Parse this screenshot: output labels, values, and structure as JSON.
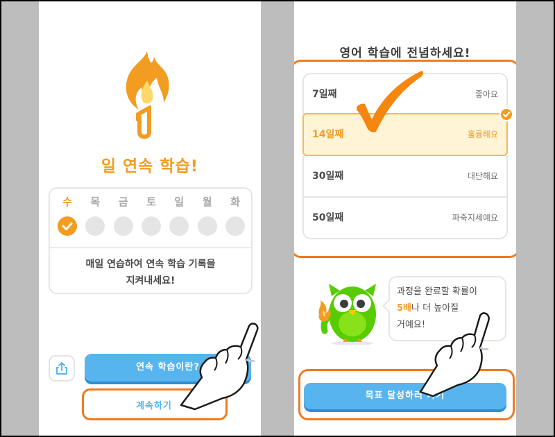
{
  "left": {
    "streak_count": "1",
    "streak_title": "일 연속 학습!",
    "weekdays": [
      {
        "label": "수",
        "done": true
      },
      {
        "label": "목",
        "done": false
      },
      {
        "label": "금",
        "done": false
      },
      {
        "label": "토",
        "done": false
      },
      {
        "label": "일",
        "done": false
      },
      {
        "label": "월",
        "done": false
      },
      {
        "label": "화",
        "done": false
      }
    ],
    "message_line1": "매일 연습하여 연속 학습 기록을",
    "message_line2": "지켜내세요!",
    "share_icon": "share-icon",
    "primary_button": "연속 학습이란?",
    "continue_button": "계속하기"
  },
  "right": {
    "title": "영어 학습에 전념하세요!",
    "goals": [
      {
        "days": "7일째",
        "desc": "좋아요",
        "selected": false
      },
      {
        "days": "14일째",
        "desc": "훌륭해요",
        "selected": true
      },
      {
        "days": "30일째",
        "desc": "대단해요",
        "selected": false
      },
      {
        "days": "50일째",
        "desc": "파죽지세예요",
        "selected": false
      }
    ],
    "bubble_line1": "과정을 완료할 확률이",
    "bubble_highlight": "5배",
    "bubble_line2_rest": "나 더 높아질",
    "bubble_line3": "거예요!",
    "primary_button": "목표 달성하러 가기"
  },
  "colors": {
    "accent_orange": "#f39c22",
    "annotation_orange": "#f07a20",
    "button_blue": "#58b4ef",
    "selected_bg": "#fff4d5"
  }
}
